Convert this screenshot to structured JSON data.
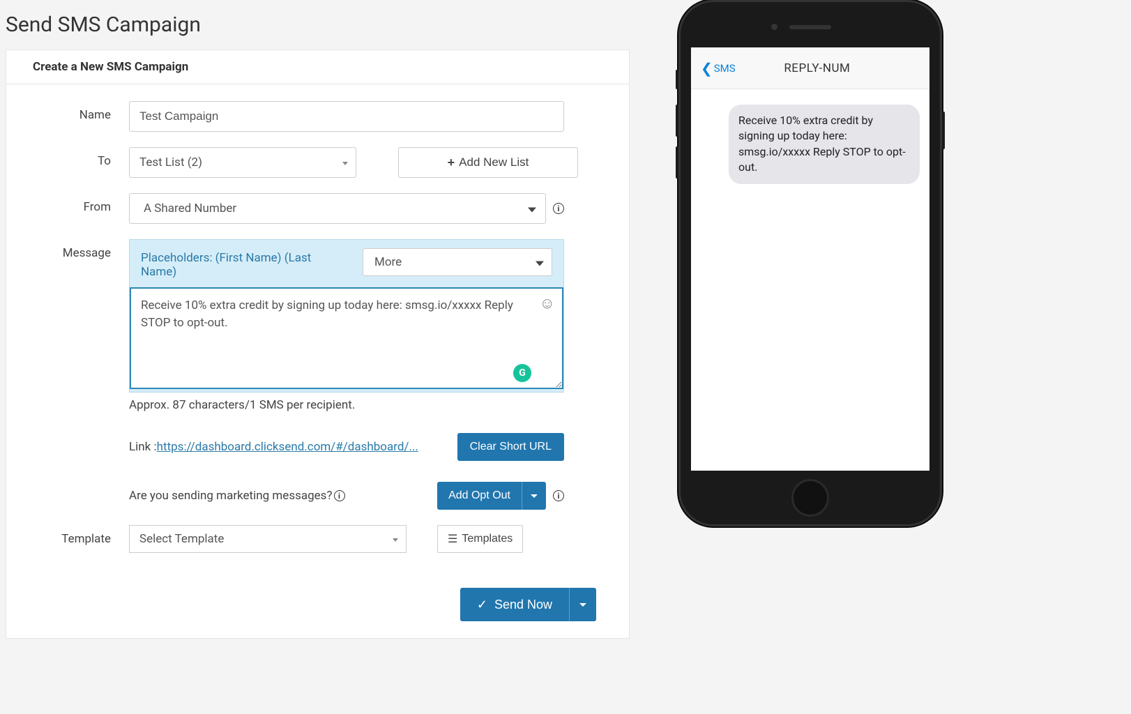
{
  "page": {
    "title": "Send SMS Campaign"
  },
  "panel": {
    "header": "Create a New SMS Campaign"
  },
  "form": {
    "name": {
      "label": "Name",
      "value": "Test Campaign"
    },
    "to": {
      "label": "To",
      "selected": "Test List (2)",
      "add_button": "Add New List"
    },
    "from": {
      "label": "From",
      "selected": "A Shared Number"
    },
    "message": {
      "label": "Message",
      "placeholders_text": "Placeholders: (First Name) (Last Name)",
      "more_label": "More",
      "value": "Receive 10% extra credit by signing up today here: smsg.io/xxxxx Reply STOP to opt-out.",
      "approx": "Approx. 87 characters/1 SMS per recipient."
    },
    "link": {
      "label": "Link : ",
      "url": "https://dashboard.clicksend.com/#/dashboard/...",
      "clear_button": "Clear Short URL"
    },
    "marketing": {
      "question": "Are you sending marketing messages? ",
      "opt_out_button": "Add Opt Out"
    },
    "template": {
      "label": "Template",
      "selected": "Select Template",
      "templates_button": "Templates"
    },
    "send_button": "Send Now"
  },
  "phone": {
    "back_label": "SMS",
    "title": "REPLY-NUM",
    "bubble": "Receive 10% extra credit by signing up today here: smsg.io/xxxxx Reply STOP to opt-out."
  },
  "info_char": "i"
}
